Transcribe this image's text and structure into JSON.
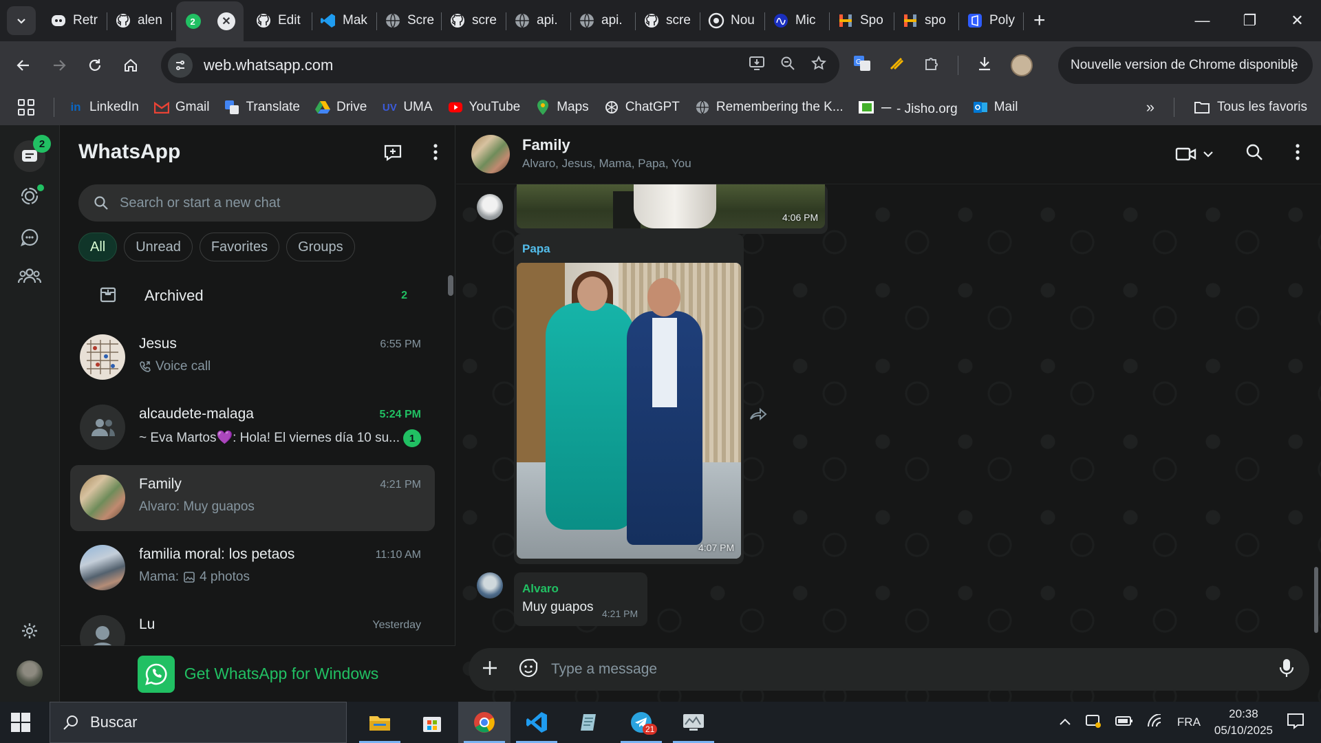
{
  "browser": {
    "tabs": [
      {
        "title": "Retr",
        "icon": "discord-icon"
      },
      {
        "title": "alen",
        "icon": "github-icon"
      },
      {
        "title": "",
        "icon": "whatsapp-icon",
        "active": true,
        "badge": "2"
      },
      {
        "title": "Edit",
        "icon": "github-icon"
      },
      {
        "title": "Mak",
        "icon": "vscode-icon"
      },
      {
        "title": "Scre",
        "icon": "globe-icon"
      },
      {
        "title": "scre",
        "icon": "github-icon"
      },
      {
        "title": "api.",
        "icon": "globe-icon"
      },
      {
        "title": "api.",
        "icon": "globe-icon"
      },
      {
        "title": "scre",
        "icon": "github-icon"
      },
      {
        "title": "Nou",
        "icon": "openai-icon"
      },
      {
        "title": "Mic",
        "icon": "meta-icon"
      },
      {
        "title": "Spo",
        "icon": "hubspot-icon"
      },
      {
        "title": "spo",
        "icon": "hubspot-icon"
      },
      {
        "title": "Poly",
        "icon": "polymarket-icon"
      }
    ],
    "url": "web.whatsapp.com",
    "update_notice": "Nouvelle version de Chrome disponible",
    "bookmarks": [
      {
        "label": "LinkedIn",
        "icon": "linkedin-icon",
        "color": "#0a66c2"
      },
      {
        "label": "Gmail",
        "icon": "gmail-icon",
        "color": "#ea4335"
      },
      {
        "label": "Translate",
        "icon": "translate-icon",
        "color": "#4285f4"
      },
      {
        "label": "Drive",
        "icon": "drive-icon",
        "color": "#fbbc04"
      },
      {
        "label": "UMA",
        "icon": "uma-icon",
        "color": "#3b5bdb"
      },
      {
        "label": "YouTube",
        "icon": "youtube-icon",
        "color": "#ff0000"
      },
      {
        "label": "Maps",
        "icon": "maps-icon",
        "color": "#34a853"
      },
      {
        "label": "ChatGPT",
        "icon": "chatgpt-icon",
        "color": "#e8eaed"
      },
      {
        "label": "Remembering the K...",
        "icon": "globe-icon",
        "color": "#e8eaed"
      },
      {
        "label": "ㄧ - Jisho.org",
        "icon": "jisho-icon",
        "color": "#43b02a"
      },
      {
        "label": "Mail",
        "icon": "outlook-icon",
        "color": "#0078d4"
      }
    ],
    "all_bookmarks": "Tous les favoris"
  },
  "whatsapp": {
    "title": "WhatsApp",
    "rail_badge": "2",
    "search_placeholder": "Search or start a new chat",
    "filters": [
      "All",
      "Unread",
      "Favorites",
      "Groups"
    ],
    "archived": {
      "label": "Archived",
      "count": "2"
    },
    "chats": [
      {
        "name": "Jesus",
        "time": "6:55 PM",
        "preview": "Voice call",
        "preview_icon": "phone-icon",
        "unread": ""
      },
      {
        "name": "alcaudete-malaga",
        "time": "5:24 PM",
        "preview": "~ Eva Martos💜: Hola! El viernes día 10 su...",
        "unread": "1"
      },
      {
        "name": "Family",
        "time": "4:21 PM",
        "preview": "Alvaro: Muy guapos",
        "unread": ""
      },
      {
        "name": "familia moral: los petaos",
        "time": "11:10 AM",
        "preview_prefix": "Mama:",
        "preview": "4 photos",
        "preview_icon": "image-icon",
        "unread": ""
      },
      {
        "name": "Lu",
        "time": "Yesterday",
        "preview": "",
        "unread": ""
      }
    ],
    "get_app": "Get WhatsApp for Windows",
    "conversation": {
      "name": "Family",
      "members": "Alvaro, Jesus, Mama, Papa, You",
      "messages": [
        {
          "type": "photo",
          "time": "4:06 PM"
        },
        {
          "type": "photo",
          "sender": "Papa",
          "sender_color": "#53bdeb",
          "time": "4:07 PM"
        },
        {
          "type": "text",
          "sender": "Alvaro",
          "sender_color": "#21c063",
          "text": "Muy guapos",
          "time": "4:21 PM"
        }
      ],
      "composer_placeholder": "Type a message"
    }
  },
  "taskbar": {
    "search_placeholder": "Buscar",
    "language": "FRA",
    "time": "20:38",
    "date": "05/10/2025",
    "telegram_badge": "21"
  }
}
